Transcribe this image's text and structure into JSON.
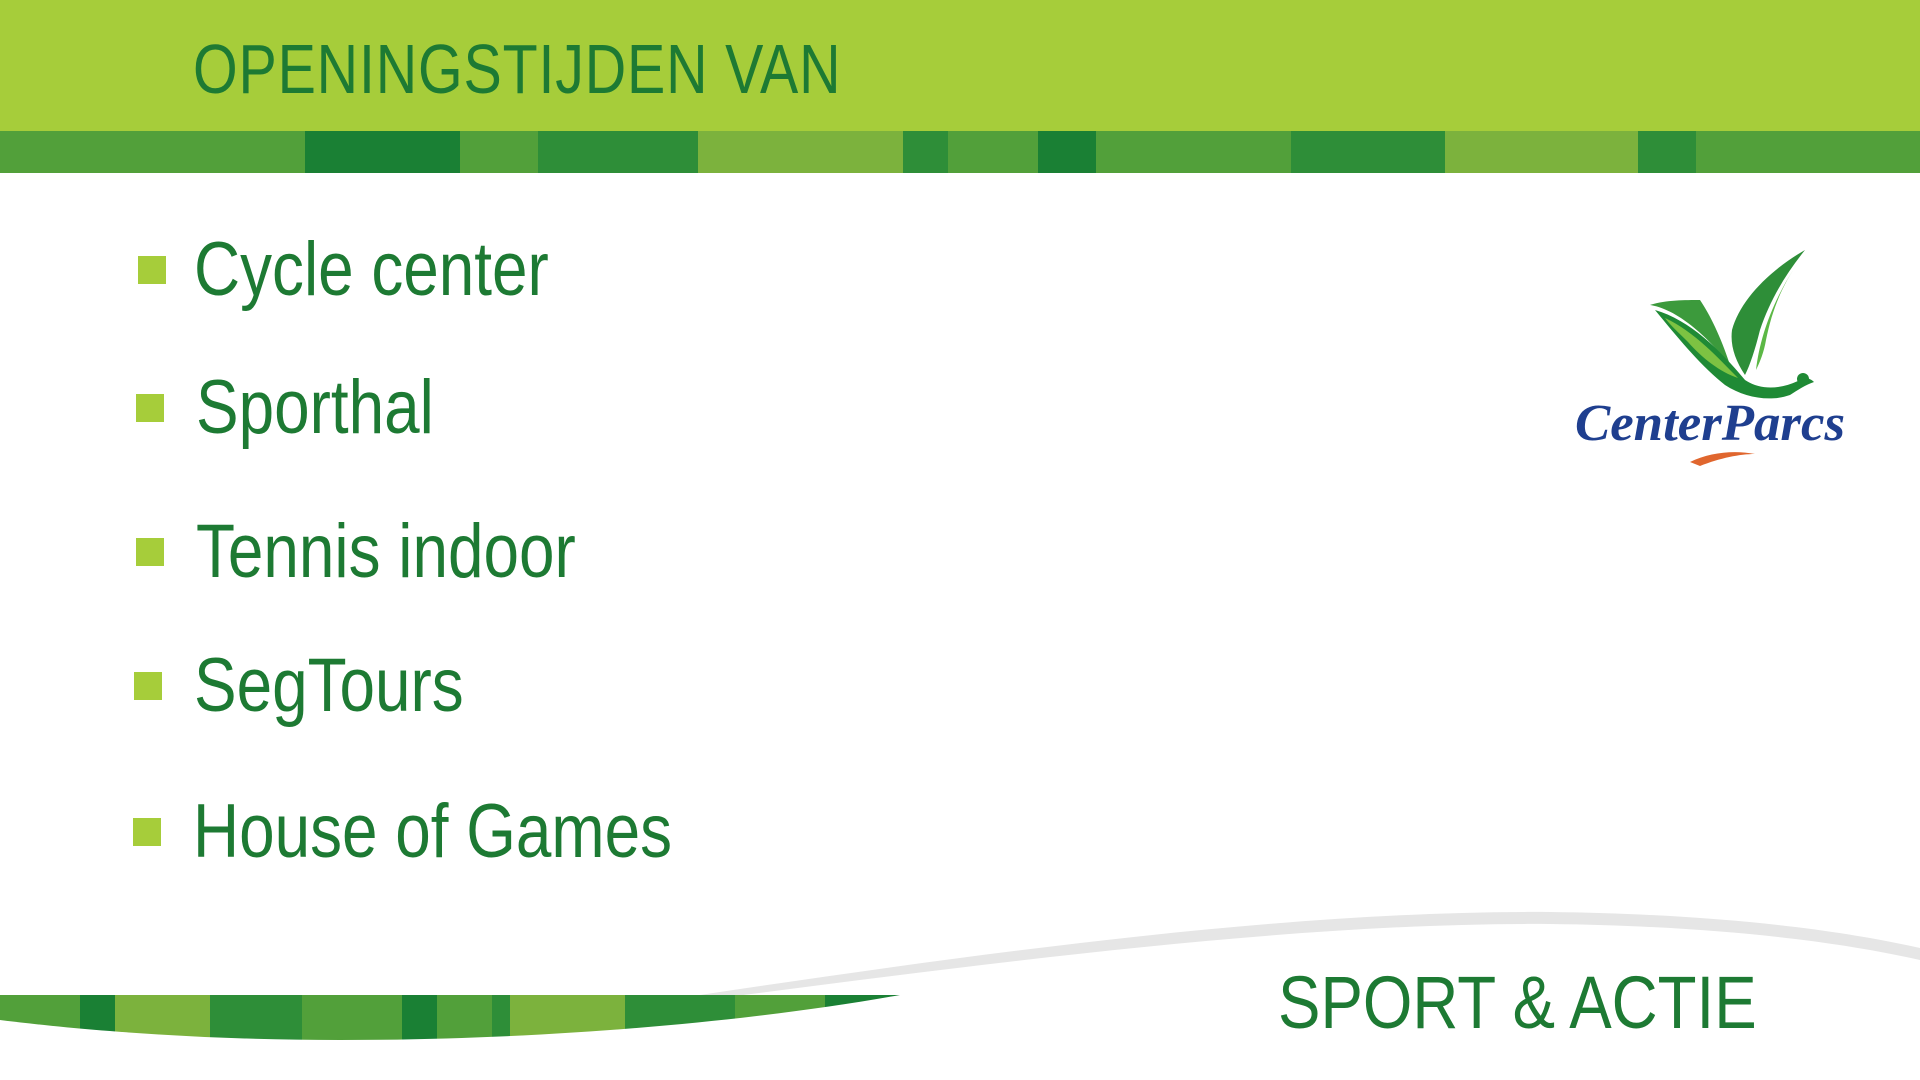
{
  "header": {
    "title": "OPENINGSTIJDEN VAN"
  },
  "items": [
    {
      "label": "Cycle center"
    },
    {
      "label": "Sporthal"
    },
    {
      "label": "Tennis indoor"
    },
    {
      "label": "SegTours"
    },
    {
      "label": "House of Games"
    }
  ],
  "logo": {
    "text": "CenterParcs",
    "icon": "bird-icon"
  },
  "footer": {
    "title": "SPORT & ACTIE"
  },
  "colors": {
    "header_bg": "#a6cd3a",
    "text_green": "#1d7a33",
    "bullet": "#a6cd3a",
    "stripe_light": "#7cb23d",
    "stripe_mid": "#52a03a",
    "stripe_dark": "#1a8034",
    "logo_blue": "#1f3f8f",
    "logo_orange": "#e0662e"
  }
}
